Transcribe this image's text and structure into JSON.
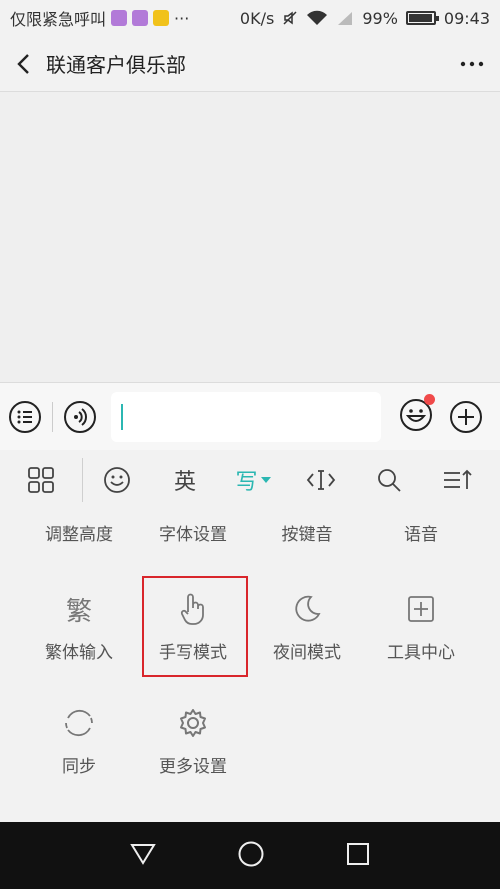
{
  "status_bar": {
    "carrier": "仅限紧急呼叫",
    "speed": "0K/s",
    "battery": "99%",
    "time": "09:43"
  },
  "header": {
    "title": "联通客户俱乐部"
  },
  "toolbar": {
    "emoji": "☺",
    "english": "英",
    "handwrite": "写",
    "cursor": "I",
    "search": "⌕",
    "sort": "≡"
  },
  "panel": {
    "top_row": [
      "调整高度",
      "字体设置",
      "按键音",
      "语音"
    ],
    "items": [
      {
        "label": "繁体输入",
        "glyph": "繁"
      },
      {
        "label": "手写模式"
      },
      {
        "label": "夜间模式"
      },
      {
        "label": "工具中心"
      },
      {
        "label": "同步"
      },
      {
        "label": "更多设置"
      }
    ]
  },
  "colors": {
    "accent": "#2bb7b2",
    "highlight_box": "#d9262c",
    "notification_dot": "#f04a4a"
  }
}
